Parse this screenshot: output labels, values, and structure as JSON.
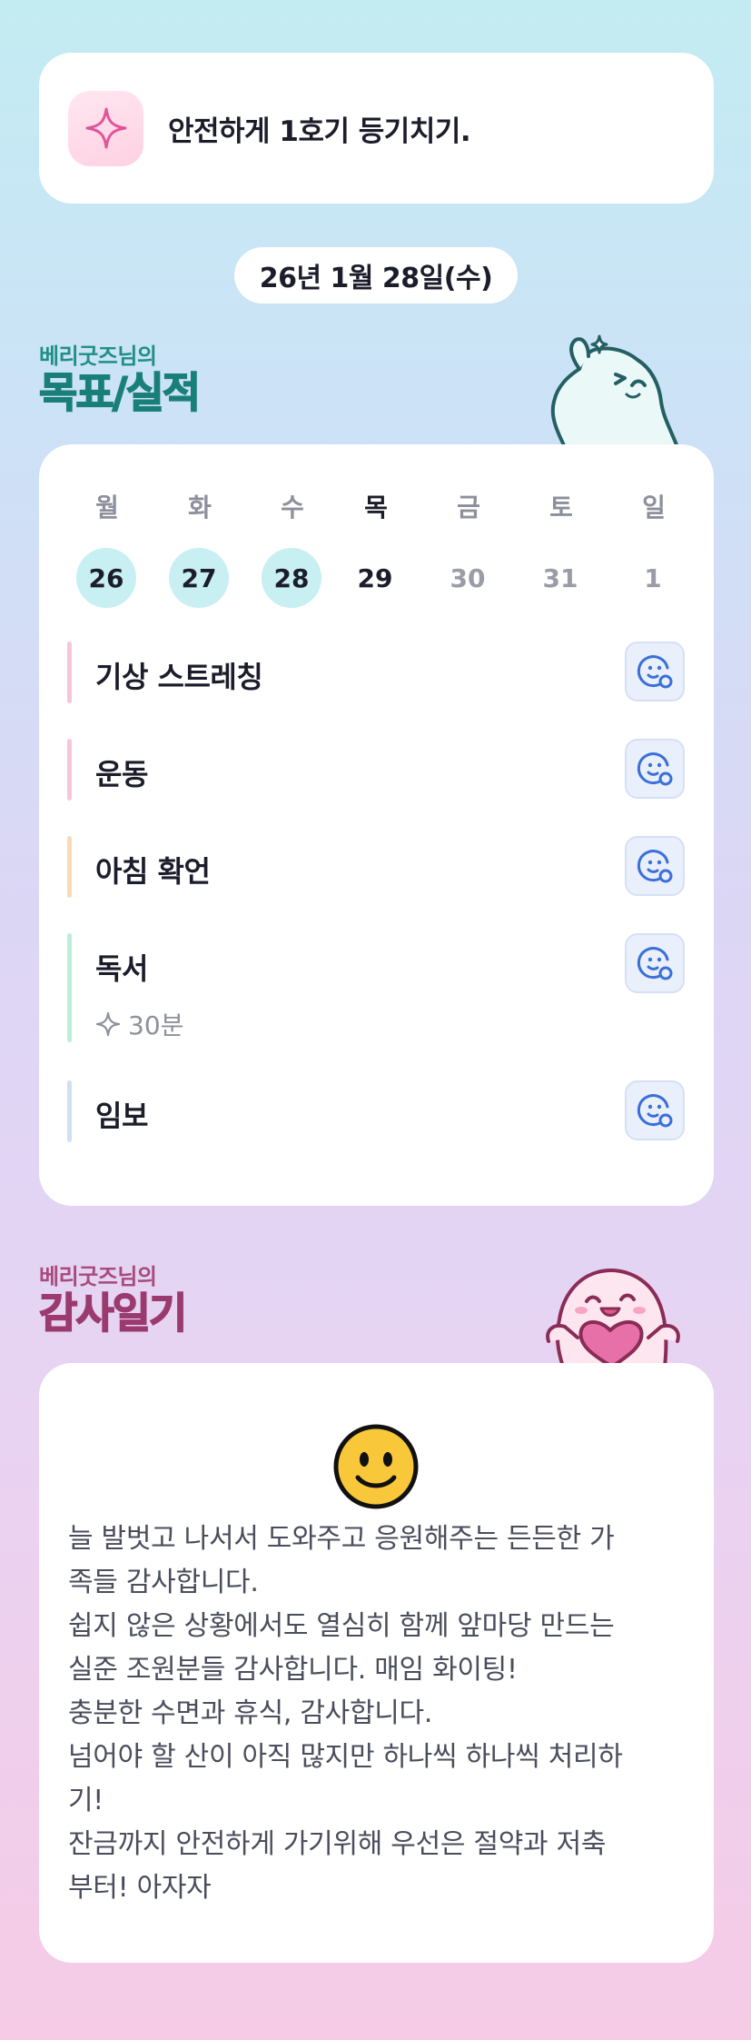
{
  "top_card": {
    "text": "안전하게 1호기 등기치기.",
    "icon": "sparkle-icon"
  },
  "date": "26년 1월 28일(수)",
  "goals_section": {
    "subtitle": "베리굿즈님의",
    "title": "목표/실적"
  },
  "week": [
    {
      "day": "월",
      "date": "26",
      "state": "done"
    },
    {
      "day": "화",
      "date": "27",
      "state": "done"
    },
    {
      "day": "수",
      "date": "28",
      "state": "done"
    },
    {
      "day": "목",
      "date": "29",
      "state": "today"
    },
    {
      "day": "금",
      "date": "30",
      "state": "future"
    },
    {
      "day": "토",
      "date": "31",
      "state": "future"
    },
    {
      "day": "일",
      "date": "1",
      "state": "future"
    }
  ],
  "goals": [
    {
      "title": "기상 스트레칭",
      "bar_color": "#f7c6da",
      "has_action": true,
      "sub": ""
    },
    {
      "title": "운동",
      "bar_color": "#f7c6da",
      "has_action": true,
      "sub": ""
    },
    {
      "title": "아침 확언",
      "bar_color": "#f9dcb5",
      "has_action": true,
      "sub": ""
    },
    {
      "title": "독서",
      "bar_color": "#bdeed9",
      "has_action": true,
      "sub": "30분"
    },
    {
      "title": "임보",
      "bar_color": "#cfe0f5",
      "has_action": true,
      "sub": ""
    }
  ],
  "thanks_section": {
    "subtitle": "베리굿즈님의",
    "title": "감사일기"
  },
  "diary_lines": [
    "늘 발벗고 나서서 도와주고 응원해주는 든든한 가",
    "족들 감사합니다.",
    "쉽지 않은 상황에서도 열심히 함께 앞마당 만드는",
    "실준 조원분들 감사합니다. 매임 화이팅!",
    "충분한 수면과 휴식, 감사합니다.",
    "넘어야 할 산이 아직 많지만 하나씩 하나씩 처리하",
    "기!",
    "잔금까지 안전하게 가기위해 우선은 절약과 저축",
    "부터! 아자자"
  ],
  "colors": {
    "accent_teal": "#1a7f78",
    "accent_pink": "#9b3a6f",
    "done_circle": "#c8eff2",
    "action_icon": "#3b6fd9"
  }
}
